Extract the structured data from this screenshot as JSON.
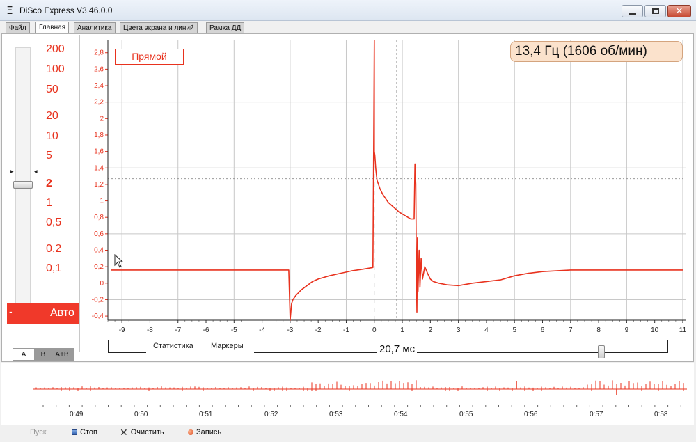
{
  "window": {
    "title": "DiSco Express V3.46.0.0",
    "icon": "sigma-icon",
    "close_glyph": "✕"
  },
  "menu": {
    "tabs": [
      "Файл",
      "Главная",
      "Аналитика",
      "Цвета экрана и линий",
      "Рамка ДД"
    ],
    "active": "Главная"
  },
  "sensitivity": {
    "labels": [
      "200",
      "100",
      "50",
      "20",
      "10",
      "5",
      "2",
      "1",
      "0,5",
      "0,2",
      "0,1"
    ],
    "selected": "2",
    "auto_label": "Авто",
    "auto_dash": "-"
  },
  "channels": {
    "tabs": [
      "A",
      "B",
      "A+B"
    ],
    "active": "A"
  },
  "scope": {
    "mode": "Прямой",
    "frequency": "13,4 Гц (1606 об/мин)",
    "statistics_label": "Статистика",
    "markers_label": "Маркеры",
    "time_window": "20,7 мс"
  },
  "chart_data": {
    "type": "line",
    "title": "",
    "xlabel": "",
    "ylabel": "",
    "xlim": [
      -9.5,
      11.1
    ],
    "ylim": [
      -0.45,
      2.95
    ],
    "x_ticks": [
      -9,
      -8,
      -7,
      -6,
      -5,
      -4,
      -3,
      -2,
      -1,
      0,
      1,
      2,
      3,
      4,
      5,
      6,
      7,
      8,
      9,
      10,
      11
    ],
    "y_ticks": [
      -0.4,
      -0.2,
      0,
      0.2,
      0.4,
      0.6,
      0.8,
      1,
      1.2,
      1.4,
      1.6,
      1.8,
      2,
      2.2,
      2.4,
      2.6,
      2.8
    ],
    "y_tick_labels": [
      "-0,4",
      "-0,2",
      "0",
      "0,2",
      "0,4",
      "0,6",
      "0,8",
      "1",
      "1,2",
      "1,4",
      "1,6",
      "1,8",
      "2",
      "2,2",
      "2,4",
      "2,6",
      "2,8"
    ],
    "grid": true,
    "color": "#e8321e",
    "series": [
      {
        "x": [
          -9.4,
          -8,
          -6,
          -4,
          -3.1,
          -3.05,
          -3.0,
          -2.95,
          -2.9,
          -2.8,
          -2.6,
          -2.4,
          -2.2,
          -2.0,
          -1.6,
          -1.2,
          -0.8,
          -0.4,
          -0.05,
          0.0,
          0.0,
          0.02,
          0.05,
          0.08,
          0.1,
          0.15,
          0.2,
          0.3,
          0.5,
          0.7,
          0.9,
          1.1,
          1.3,
          1.42,
          1.45,
          1.48,
          1.5,
          1.52,
          1.54,
          1.56,
          1.6,
          1.63,
          1.67,
          1.72,
          1.8,
          1.9,
          2.0,
          2.1,
          2.3,
          2.6,
          3.0,
          3.5,
          4.0,
          4.5,
          5.0,
          5.5,
          6.0,
          6.5,
          7.0,
          8.0,
          9.0,
          10.0,
          11.0
        ],
        "y": [
          0.16,
          0.16,
          0.16,
          0.16,
          0.16,
          0.16,
          -0.45,
          -0.25,
          -0.2,
          -0.15,
          -0.08,
          -0.03,
          0.02,
          0.05,
          0.09,
          0.12,
          0.15,
          0.17,
          0.19,
          3.0,
          1.6,
          1.55,
          1.4,
          1.3,
          1.25,
          1.2,
          1.15,
          1.08,
          0.98,
          0.92,
          0.86,
          0.82,
          0.78,
          0.78,
          1.45,
          1.2,
          0.2,
          -0.35,
          0.55,
          -0.1,
          0.4,
          -0.05,
          0.3,
          0.05,
          0.2,
          0.12,
          0.05,
          0.02,
          0.0,
          -0.02,
          -0.03,
          0.0,
          0.02,
          0.04,
          0.09,
          0.12,
          0.14,
          0.15,
          0.16,
          0.16,
          0.16,
          0.16,
          0.16
        ]
      }
    ],
    "markers_x": [
      0.8
    ]
  },
  "recorder": {
    "time_labels": [
      "0:49",
      "0:50",
      "0:51",
      "0:52",
      "0:53",
      "0:54",
      "0:55",
      "0:56",
      "0:57",
      "0:58"
    ],
    "controls": {
      "start": "Пуск",
      "stop": "Стоп",
      "clear": "Очистить",
      "record": "Запись"
    }
  }
}
